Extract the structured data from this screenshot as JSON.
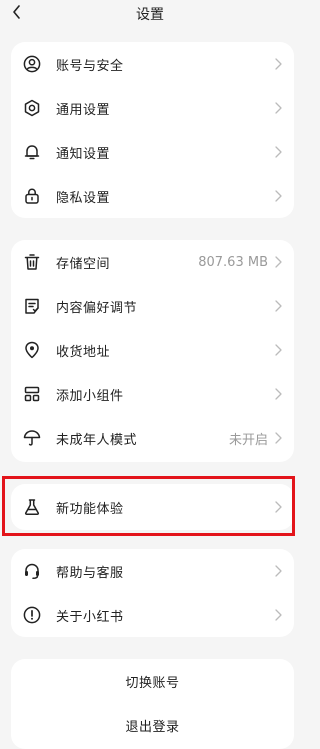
{
  "header": {
    "title": "设置"
  },
  "group1": [
    {
      "label": "账号与安全",
      "icon": "user-circle-icon"
    },
    {
      "label": "通用设置",
      "icon": "gear-icon"
    },
    {
      "label": "通知设置",
      "icon": "bell-icon"
    },
    {
      "label": "隐私设置",
      "icon": "lock-icon"
    }
  ],
  "group2": [
    {
      "label": "存储空间",
      "icon": "trash-icon",
      "value": "807.63 MB"
    },
    {
      "label": "内容偏好调节",
      "icon": "document-icon",
      "value": ""
    },
    {
      "label": "收货地址",
      "icon": "location-pin-icon",
      "value": ""
    },
    {
      "label": "添加小组件",
      "icon": "widget-grid-icon",
      "value": ""
    },
    {
      "label": "未成年人模式",
      "icon": "umbrella-icon",
      "value": "未开启"
    }
  ],
  "group3": [
    {
      "label": "新功能体验",
      "icon": "flask-icon"
    }
  ],
  "group4": [
    {
      "label": "帮助与客服",
      "icon": "headset-icon"
    },
    {
      "label": "关于小红书",
      "icon": "exclamation-circle-icon"
    }
  ],
  "actions": {
    "switch_account": "切换账号",
    "logout": "退出登录"
  },
  "colors": {
    "background": "#f5f5f5",
    "card": "#ffffff",
    "highlight_border": "#e3141a",
    "secondary_text": "#9a9a9a"
  }
}
